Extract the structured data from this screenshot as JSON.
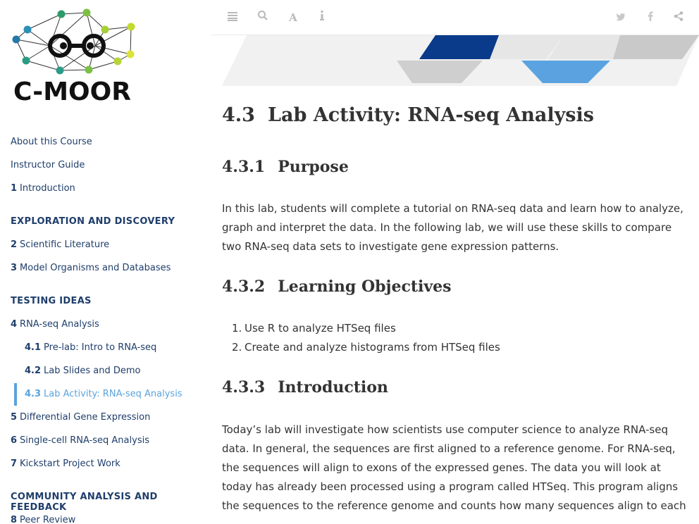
{
  "logo": {
    "text": "C-MOOR"
  },
  "nav": {
    "about": "About this Course",
    "instructor": "Instructor Guide",
    "intro": {
      "num": "1",
      "label": "Introduction"
    },
    "section_exploration": "Exploration and Discovery",
    "sci_lit": {
      "num": "2",
      "label": "Scientific Literature"
    },
    "model_orgs": {
      "num": "3",
      "label": "Model Organisms and Databases"
    },
    "section_testing": "Testing Ideas",
    "rnaseq": {
      "num": "4",
      "label": "RNA-seq Analysis"
    },
    "prelab": {
      "num": "4.1",
      "label": "Pre-lab: Intro to RNA-seq"
    },
    "slides": {
      "num": "4.2",
      "label": "Lab Slides and Demo"
    },
    "activity": {
      "num": "4.3",
      "label": "Lab Activity: RNA-seq Analysis"
    },
    "diffexp": {
      "num": "5",
      "label": "Differential Gene Expression"
    },
    "singlecell": {
      "num": "6",
      "label": "Single-cell RNA-seq Analysis"
    },
    "kickstart": {
      "num": "7",
      "label": "Kickstart Project Work"
    },
    "section_community": "Community Analysis and Feedback",
    "peer": {
      "num": "8",
      "label": "Peer Review"
    }
  },
  "toolbar": {
    "icons": [
      "menu-icon",
      "search-icon",
      "font-icon",
      "info-icon",
      "twitter-icon",
      "facebook-icon",
      "share-icon"
    ]
  },
  "content": {
    "title": {
      "num": "4.3",
      "text": "Lab Activity: RNA-seq Analysis"
    },
    "purpose": {
      "num": "4.3.1",
      "text": "Purpose"
    },
    "purpose_body": "In this lab, students will complete a tutorial on RNA-seq data and learn how to analyze, graph and interpret the data. In the following lab, we will use these skills to compare two RNA-seq data sets to investigate gene expression patterns.",
    "objectives": {
      "num": "4.3.2",
      "text": "Learning Objectives"
    },
    "objective_items": [
      "Use R to analyze HTSeq files",
      "Create and analyze histograms from HTSeq files"
    ],
    "introduction": {
      "num": "4.3.3",
      "text": "Introduction"
    },
    "intro_body": "Today’s lab will investigate how scientists use computer science to analyze RNA-seq data. In general, the sequences are first aligned to a reference genome. For RNA-seq, the sequences will align to exons of the expressed genes. The data you will look at today has already been processed using a program called HTSeq. This program aligns the sequences to the reference genome and counts how many sequences align to each"
  },
  "colors": {
    "nav_text": "#1f3e6b",
    "active": "#5ba3dc",
    "banner_navy": "#0a3a8a",
    "banner_blue": "#5ba3e0",
    "banner_gray": "#cfcfcf"
  }
}
